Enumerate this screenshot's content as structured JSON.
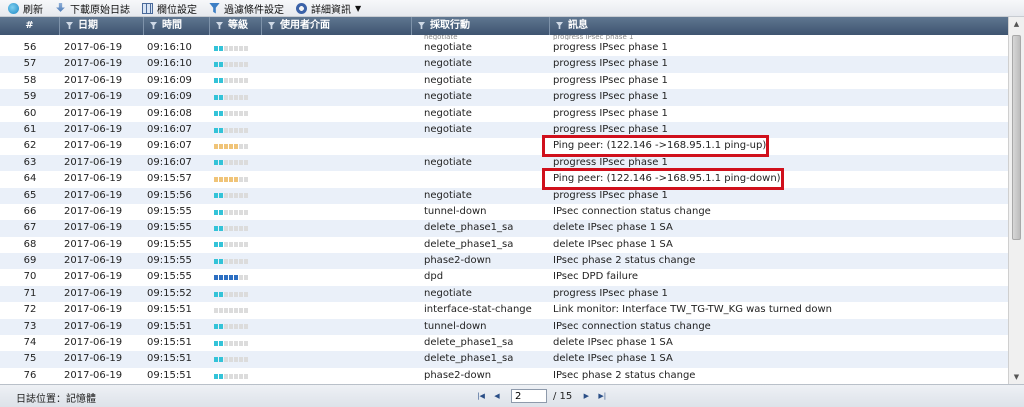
{
  "toolbar": {
    "refresh": "刷新",
    "download": "下載原始日誌",
    "columns": "欄位設定",
    "filter": "過濾條件設定",
    "details": "詳細資訊"
  },
  "columns": {
    "num": "#",
    "date": "日期",
    "time": "時間",
    "level": "等級",
    "user": "使用者介面",
    "action": "採取行動",
    "message": "訊息"
  },
  "partial_row": {
    "action": "negotiate",
    "message": "progress IPsec phase 1"
  },
  "rows": [
    {
      "num": "56",
      "date": "2017-06-19",
      "time": "09:16:10",
      "level": "info",
      "action": "negotiate",
      "message": "progress IPsec phase 1"
    },
    {
      "num": "57",
      "date": "2017-06-19",
      "time": "09:16:10",
      "level": "info",
      "action": "negotiate",
      "message": "progress IPsec phase 1"
    },
    {
      "num": "58",
      "date": "2017-06-19",
      "time": "09:16:09",
      "level": "info",
      "action": "negotiate",
      "message": "progress IPsec phase 1"
    },
    {
      "num": "59",
      "date": "2017-06-19",
      "time": "09:16:09",
      "level": "info",
      "action": "negotiate",
      "message": "progress IPsec phase 1"
    },
    {
      "num": "60",
      "date": "2017-06-19",
      "time": "09:16:08",
      "level": "info",
      "action": "negotiate",
      "message": "progress IPsec phase 1"
    },
    {
      "num": "61",
      "date": "2017-06-19",
      "time": "09:16:07",
      "level": "info",
      "action": "negotiate",
      "message": "progress IPsec phase 1"
    },
    {
      "num": "62",
      "date": "2017-06-19",
      "time": "09:16:07",
      "level": "warn",
      "action": "",
      "message": "Ping peer: (122.146            ->168.95.1.1 ping-up)",
      "highlight": true
    },
    {
      "num": "63",
      "date": "2017-06-19",
      "time": "09:16:07",
      "level": "info",
      "action": "negotiate",
      "message": "progress IPsec phase 1"
    },
    {
      "num": "64",
      "date": "2017-06-19",
      "time": "09:15:57",
      "level": "warn",
      "action": "",
      "message": "Ping peer: (122.146            ->168.95.1.1 ping-down)",
      "highlight": true
    },
    {
      "num": "65",
      "date": "2017-06-19",
      "time": "09:15:56",
      "level": "info",
      "action": "negotiate",
      "message": "progress IPsec phase 1"
    },
    {
      "num": "66",
      "date": "2017-06-19",
      "time": "09:15:55",
      "level": "info",
      "action": "tunnel-down",
      "message": "IPsec connection status change"
    },
    {
      "num": "67",
      "date": "2017-06-19",
      "time": "09:15:55",
      "level": "info",
      "action": "delete_phase1_sa",
      "message": "delete IPsec phase 1 SA"
    },
    {
      "num": "68",
      "date": "2017-06-19",
      "time": "09:15:55",
      "level": "info",
      "action": "delete_phase1_sa",
      "message": "delete IPsec phase 1 SA"
    },
    {
      "num": "69",
      "date": "2017-06-19",
      "time": "09:15:55",
      "level": "info",
      "action": "phase2-down",
      "message": "IPsec phase 2 status change"
    },
    {
      "num": "70",
      "date": "2017-06-19",
      "time": "09:15:55",
      "level": "err",
      "action": "dpd",
      "message": "IPsec DPD failure"
    },
    {
      "num": "71",
      "date": "2017-06-19",
      "time": "09:15:52",
      "level": "info",
      "action": "negotiate",
      "message": "progress IPsec phase 1"
    },
    {
      "num": "72",
      "date": "2017-06-19",
      "time": "09:15:51",
      "level": "none",
      "action": "interface-stat-change",
      "message": "Link monitor: Interface TW_TG-TW_KG was turned down"
    },
    {
      "num": "73",
      "date": "2017-06-19",
      "time": "09:15:51",
      "level": "info",
      "action": "tunnel-down",
      "message": "IPsec connection status change"
    },
    {
      "num": "74",
      "date": "2017-06-19",
      "time": "09:15:51",
      "level": "info",
      "action": "delete_phase1_sa",
      "message": "delete IPsec phase 1 SA"
    },
    {
      "num": "75",
      "date": "2017-06-19",
      "time": "09:15:51",
      "level": "info",
      "action": "delete_phase1_sa",
      "message": "delete IPsec phase 1 SA"
    },
    {
      "num": "76",
      "date": "2017-06-19",
      "time": "09:15:51",
      "level": "info",
      "action": "phase2-down",
      "message": "IPsec phase 2 status change"
    }
  ],
  "footer": {
    "location": "日誌位置：記憶體",
    "page": "2",
    "total": "/ 15"
  },
  "colors": {
    "header": "#4e647e",
    "alt_row": "#eaf0f9",
    "highlight": "#d0101c",
    "level_info": "#33c3d8",
    "level_warn": "#f0c478",
    "level_err": "#2d6fc2"
  }
}
